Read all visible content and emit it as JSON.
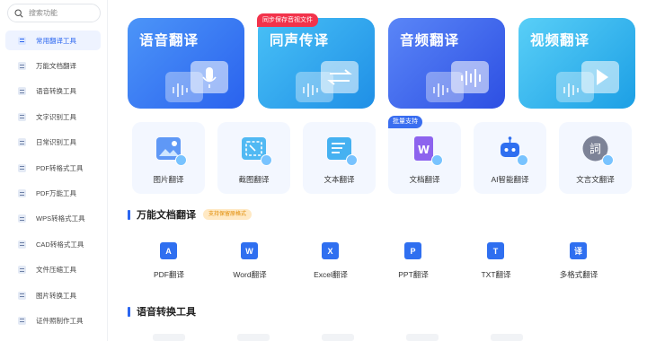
{
  "search": {
    "placeholder": "搜索功能"
  },
  "sidebar": {
    "items": [
      {
        "label": "常用翻译工具",
        "active": true
      },
      {
        "label": "万能文档翻译"
      },
      {
        "label": "语音转换工具"
      },
      {
        "label": "文字识别工具"
      },
      {
        "label": "日常识别工具"
      },
      {
        "label": "PDF转格式工具"
      },
      {
        "label": "PDF万能工具"
      },
      {
        "label": "WPS转格式工具"
      },
      {
        "label": "CAD转格式工具"
      },
      {
        "label": "文件压缩工具"
      },
      {
        "label": "图片转换工具"
      },
      {
        "label": "证件照制作工具"
      }
    ]
  },
  "big_cards": [
    {
      "title": "语音翻译",
      "colors": [
        "#2a62ee",
        "#4c95f8"
      ]
    },
    {
      "title": "同声传译",
      "colors": [
        "#1f8fe6",
        "#48c0f6"
      ]
    },
    {
      "title": "音频翻译",
      "colors": [
        "#2d4fe3",
        "#5a86f7"
      ]
    },
    {
      "title": "视频翻译",
      "colors": [
        "#1c9fe5",
        "#59cff7"
      ]
    }
  ],
  "ribbon": {
    "label": "同步保存音视文件"
  },
  "tools": [
    {
      "label": "图片翻译",
      "icon": "image-translate-icon",
      "color": "#4f8df5"
    },
    {
      "label": "截图翻译",
      "icon": "screenshot-translate-icon",
      "color": "#3fb1f2"
    },
    {
      "label": "文本翻译",
      "icon": "text-translate-icon",
      "color": "#32a9f0"
    },
    {
      "label": "文档翻译",
      "icon": "document-translate-icon",
      "color": "#8d63ee"
    },
    {
      "label": "AI智能翻译",
      "icon": "ai-robot-icon",
      "color": "#3b82f6"
    },
    {
      "label": "文言文翻译",
      "icon": "classical-chinese-icon",
      "color": "#8c91a3"
    }
  ],
  "scan_badge": {
    "label": "批量支持"
  },
  "section1": {
    "title": "万能文档翻译",
    "tag": "支持保留原格式"
  },
  "section2": {
    "title": "语音转换工具"
  },
  "doc_tools": [
    {
      "label": "PDF翻译",
      "icon": "pdf-icon",
      "color": "#2f6ff0",
      "glyph": "A"
    },
    {
      "label": "Word翻译",
      "icon": "word-icon",
      "color": "#2f6ff0",
      "glyph": "W"
    },
    {
      "label": "Excel翻译",
      "icon": "excel-icon",
      "color": "#2f6ff0",
      "glyph": "X"
    },
    {
      "label": "PPT翻译",
      "icon": "ppt-icon",
      "color": "#2f6ff0",
      "glyph": "P"
    },
    {
      "label": "TXT翻译",
      "icon": "txt-icon",
      "color": "#2f6ff0",
      "glyph": "T"
    },
    {
      "label": "多格式翻译",
      "icon": "multi-format-icon",
      "color": "#2f6ff0",
      "glyph": "译"
    }
  ]
}
